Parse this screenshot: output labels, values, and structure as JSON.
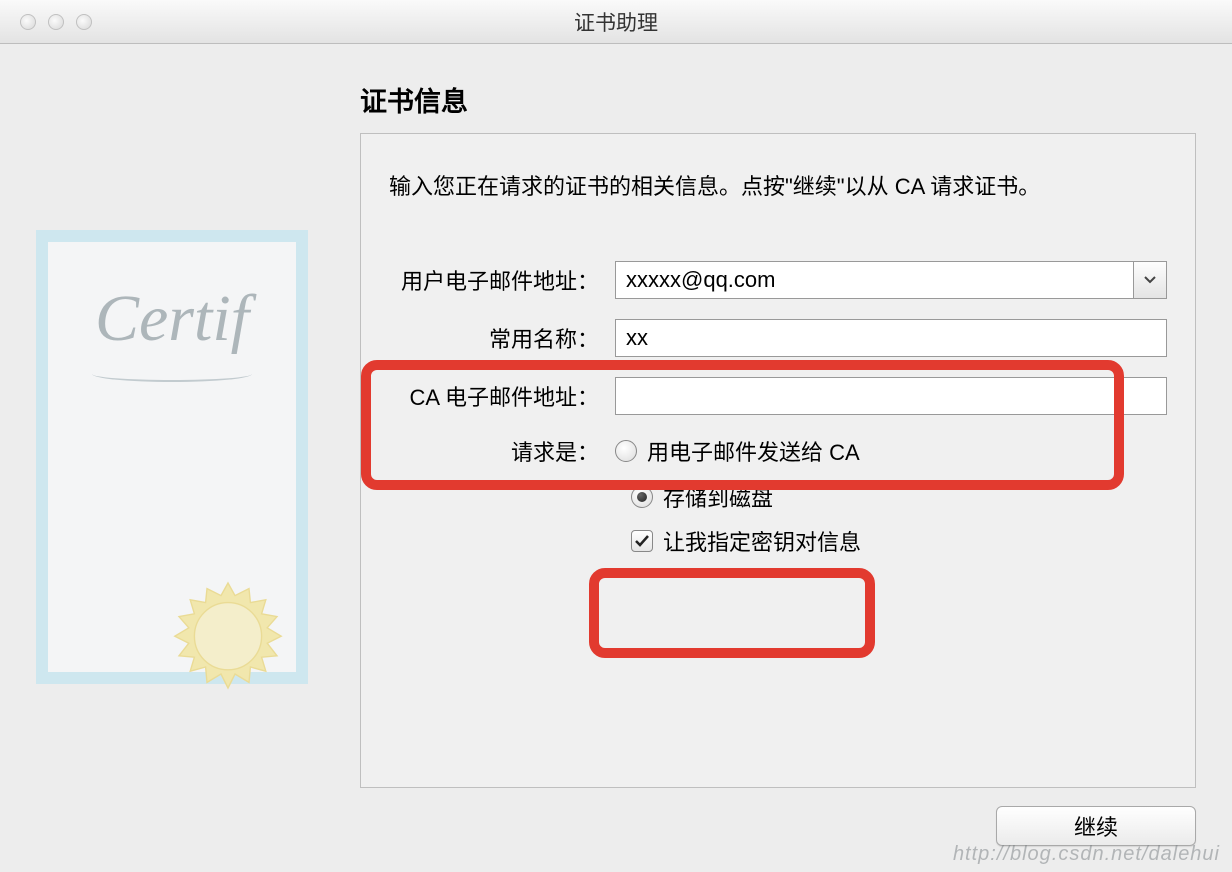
{
  "window": {
    "title": "证书助理"
  },
  "page": {
    "heading": "证书信息",
    "instructions": "输入您正在请求的证书的相关信息。点按\"继续\"以从 CA 请求证书。"
  },
  "form": {
    "email_label": "用户电子邮件地址：",
    "email_value": "xxxxx@qq.com",
    "name_label": "常用名称：",
    "name_value": "xx",
    "ca_email_label": "CA 电子邮件地址：",
    "ca_email_value": "",
    "request_label": "请求是：",
    "radio_email_ca": "用电子邮件发送给 CA",
    "radio_save_disk": "存储到磁盘",
    "checkbox_keypair": "让我指定密钥对信息"
  },
  "buttons": {
    "continue": "继续"
  },
  "illustration": {
    "script_text": "Certif"
  },
  "watermark": "http://blog.csdn.net/dalehui"
}
